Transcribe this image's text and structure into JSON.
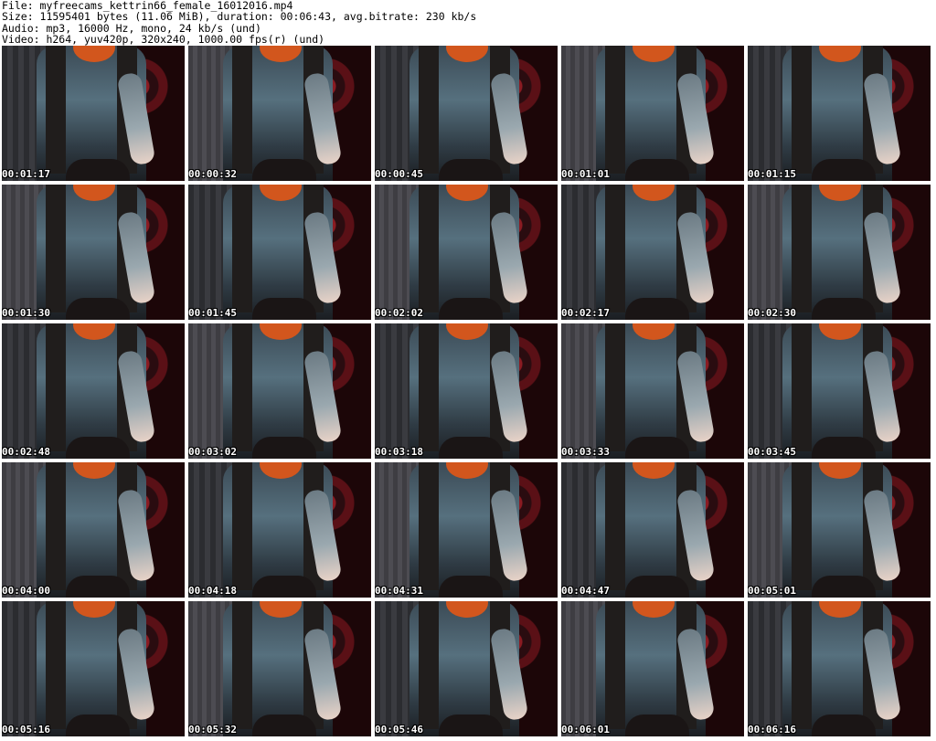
{
  "info": {
    "file": "File: myfreecams_kettrin66_female_16012016.mp4",
    "size": "Size: 11595401 bytes (11.06 MiB), duration: 00:06:43, avg.bitrate: 230 kb/s",
    "audio": "Audio: mp3, 16000 Hz, mono, 24 kb/s (und)",
    "video": "Video: h264, yuv420p, 320x240, 1000.00 fps(r) (und)"
  },
  "thumbnails": [
    {
      "time": "00:01:17"
    },
    {
      "time": "00:00:32"
    },
    {
      "time": "00:00:45"
    },
    {
      "time": "00:01:01"
    },
    {
      "time": "00:01:15"
    },
    {
      "time": "00:01:30"
    },
    {
      "time": "00:01:45"
    },
    {
      "time": "00:02:02"
    },
    {
      "time": "00:02:17"
    },
    {
      "time": "00:02:30"
    },
    {
      "time": "00:02:48"
    },
    {
      "time": "00:03:02"
    },
    {
      "time": "00:03:18"
    },
    {
      "time": "00:03:33"
    },
    {
      "time": "00:03:45"
    },
    {
      "time": "00:04:00"
    },
    {
      "time": "00:04:18"
    },
    {
      "time": "00:04:31"
    },
    {
      "time": "00:04:47"
    },
    {
      "time": "00:05:01"
    },
    {
      "time": "00:05:16"
    },
    {
      "time": "00:05:32"
    },
    {
      "time": "00:05:46"
    },
    {
      "time": "00:06:01"
    },
    {
      "time": "00:06:16"
    }
  ]
}
